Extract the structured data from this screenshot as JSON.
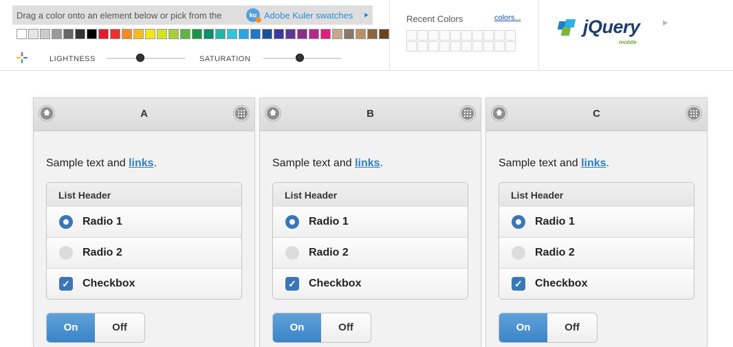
{
  "toolbar": {
    "drag_instruction": "Drag a color onto an element below or pick from the",
    "kuler_badge": "ku",
    "kuler_link": "Adobe Kuler swatches",
    "swatches": [
      "#ffffff",
      "#e6e6e6",
      "#cccccc",
      "#999999",
      "#666666",
      "#333333",
      "#000000",
      "#e61b2e",
      "#f02c2c",
      "#f58a1f",
      "#fbbc1b",
      "#f5e51b",
      "#d6e11f",
      "#a6ce39",
      "#5bb543",
      "#1a9545",
      "#0b8f6a",
      "#1fb6a6",
      "#2ec5dd",
      "#29a5e3",
      "#1f78c8",
      "#1b4f9c",
      "#3a3a9c",
      "#5b3896",
      "#8c2e8e",
      "#b42b8c",
      "#e01e7d",
      "#c7a88a",
      "#8c7763",
      "#b89166",
      "#8b6440",
      "#6b4220"
    ],
    "lightness_label": "LIGHTNESS",
    "saturation_label": "SATURATION",
    "lightness_value": 0.42,
    "saturation_value": 0.46
  },
  "recent": {
    "title": "Recent Colors",
    "link": "colors...",
    "cells": 20
  },
  "logo": {
    "wordmark": "jQuery",
    "sub": "mobile"
  },
  "panels": [
    {
      "title": "A",
      "sample": "Sample text and ",
      "link": "links",
      "period": ".",
      "list_header": "List Header",
      "radio1": "Radio 1",
      "radio2": "Radio 2",
      "checkbox": "Checkbox",
      "on": "On",
      "off": "Off"
    },
    {
      "title": "B",
      "sample": "Sample text and ",
      "link": "links",
      "period": ".",
      "list_header": "List Header",
      "radio1": "Radio 1",
      "radio2": "Radio 2",
      "checkbox": "Checkbox",
      "on": "On",
      "off": "Off"
    },
    {
      "title": "C",
      "sample": "Sample text and ",
      "link": "links",
      "period": ".",
      "list_header": "List Header",
      "radio1": "Radio 1",
      "radio2": "Radio 2",
      "checkbox": "Checkbox",
      "on": "On",
      "off": "Off"
    }
  ],
  "colors": {
    "accent": "#3b77b7",
    "link": "#2f7fc1",
    "toggle_on": "#4a8fd0"
  }
}
